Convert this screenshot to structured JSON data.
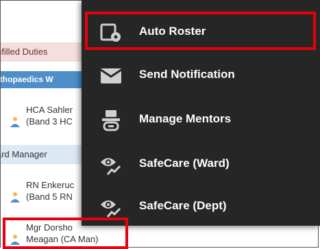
{
  "left_panel": {
    "unfilled_duties": "nfilled Duties",
    "ward_header": "rthopaedics W",
    "staff": [
      {
        "line1": "HCA Sahler",
        "line2": "(Band 3 HC"
      },
      {
        "line1": "RN Enkeruc",
        "line2": "(Band 5 RN"
      },
      {
        "line1": "Mgr Dorsho",
        "line2": "Meagan (CA Man)"
      }
    ],
    "section_label": "ard Manager"
  },
  "menu": {
    "items": [
      {
        "label": "Auto Roster",
        "icon": "auto-roster-icon"
      },
      {
        "label": "Send Notification",
        "icon": "envelope-icon"
      },
      {
        "label": "Manage Mentors",
        "icon": "mentor-link-icon"
      },
      {
        "label": "SafeCare (Ward)",
        "icon": "safecare-icon"
      },
      {
        "label": "SafeCare (Dept)",
        "icon": "safecare-icon"
      }
    ]
  },
  "colors": {
    "menu_bg": "#262626",
    "highlight": "#e8000b",
    "ward_header_bg": "#4f8fc9",
    "unfilled_bg": "#f6dede",
    "manager_bg": "#dde8f5"
  }
}
